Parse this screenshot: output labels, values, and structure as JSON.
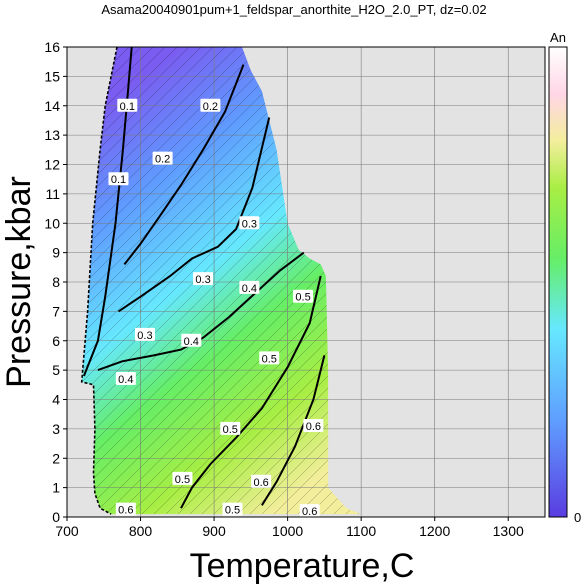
{
  "chart_data": {
    "type": "heatmap",
    "title": "Asama20040901pum+1_feldspar_anorthite_H2O_2.0_PT, dz=0.02",
    "xlabel": "Temperature,C",
    "ylabel": "Pressure,kbar",
    "xlim": [
      700,
      1350
    ],
    "ylim": [
      0,
      16
    ],
    "x_ticks": [
      "700",
      "800",
      "900",
      "1000",
      "1100",
      "1200",
      "1300"
    ],
    "y_ticks": [
      "0",
      "1",
      "2",
      "3",
      "4",
      "5",
      "6",
      "7",
      "8",
      "9",
      "10",
      "11",
      "12",
      "13",
      "14",
      "15",
      "16"
    ],
    "grid": true,
    "background_color": "#e3e3e3",
    "colorbar": {
      "title": "An",
      "min_label": "0",
      "min": 0,
      "max": 1,
      "colors": [
        "#7a5cf0",
        "#5f9cff",
        "#66e8ff",
        "#66ee66",
        "#a8ee44",
        "#f3ee9c",
        "#ffd6e6",
        "#ffffff"
      ]
    },
    "field_boundary_left": [
      [
        768,
        16
      ],
      [
        760,
        15
      ],
      [
        752,
        14
      ],
      [
        745,
        12.5
      ],
      [
        735,
        10
      ],
      [
        728,
        7
      ],
      [
        720,
        4.6
      ],
      [
        736,
        4.5
      ],
      [
        738,
        3
      ],
      [
        736,
        1.5
      ],
      [
        738,
        0.8
      ],
      [
        745,
        0.3
      ],
      [
        760,
        0.1
      ]
    ],
    "field_boundary_right": [
      [
        938,
        16
      ],
      [
        950,
        15.2
      ],
      [
        965,
        14.5
      ],
      [
        985,
        12.5
      ],
      [
        1000,
        10
      ],
      [
        1015,
        9.1
      ],
      [
        1030,
        8.8
      ],
      [
        1045,
        8.6
      ],
      [
        1052,
        8.2
      ],
      [
        1055,
        5
      ],
      [
        1055,
        1
      ],
      [
        1080,
        0.3
      ],
      [
        1100,
        0.1
      ]
    ],
    "contours": [
      {
        "level": "0.1",
        "points": [
          [
            788,
            16
          ],
          [
            783,
            14.5
          ],
          [
            776,
            12.5
          ],
          [
            766,
            10
          ],
          [
            752,
            7.5
          ],
          [
            742,
            6
          ],
          [
            723,
            4.8
          ]
        ]
      },
      {
        "level": "0.2",
        "points": [
          [
            940,
            15.4
          ],
          [
            915,
            13.8
          ],
          [
            885,
            12.5
          ],
          [
            855,
            11.3
          ],
          [
            825,
            10.2
          ],
          [
            800,
            9.3
          ],
          [
            778,
            8.6
          ]
        ]
      },
      {
        "level": "0.3",
        "points": [
          [
            975,
            13.6
          ],
          [
            952,
            11.2
          ],
          [
            930,
            9.8
          ],
          [
            905,
            9.2
          ],
          [
            870,
            8.8
          ],
          [
            840,
            8.2
          ],
          [
            800,
            7.5
          ],
          [
            770,
            7.0
          ]
        ]
      },
      {
        "level": "0.4",
        "points": [
          [
            1022,
            9.0
          ],
          [
            990,
            8.4
          ],
          [
            955,
            7.6
          ],
          [
            920,
            6.8
          ],
          [
            885,
            6.1
          ],
          [
            855,
            5.7
          ],
          [
            818,
            5.5
          ],
          [
            775,
            5.3
          ],
          [
            742,
            5.0
          ]
        ]
      },
      {
        "level": "0.5",
        "points": [
          [
            1045,
            8.2
          ],
          [
            1030,
            6.6
          ],
          [
            1000,
            5.1
          ],
          [
            965,
            3.7
          ],
          [
            930,
            2.7
          ],
          [
            895,
            1.8
          ],
          [
            870,
            1.0
          ],
          [
            855,
            0.3
          ]
        ]
      },
      {
        "level": "0.6",
        "points": [
          [
            1050,
            5.5
          ],
          [
            1035,
            4.0
          ],
          [
            1010,
            2.4
          ],
          [
            985,
            1.2
          ],
          [
            965,
            0.4
          ]
        ]
      }
    ],
    "contour_labels": [
      {
        "text": "0.1",
        "x": 782,
        "y": 14.0
      },
      {
        "text": "0.1",
        "x": 770,
        "y": 11.5
      },
      {
        "text": "0.2",
        "x": 895,
        "y": 14.0
      },
      {
        "text": "0.2",
        "x": 830,
        "y": 12.2
      },
      {
        "text": "0.3",
        "x": 948,
        "y": 10.0
      },
      {
        "text": "0.3",
        "x": 885,
        "y": 8.1
      },
      {
        "text": "0.3",
        "x": 806,
        "y": 6.2
      },
      {
        "text": "0.4",
        "x": 948,
        "y": 7.8
      },
      {
        "text": "0.4",
        "x": 869,
        "y": 6.0
      },
      {
        "text": "0.4",
        "x": 780,
        "y": 4.7
      },
      {
        "text": "0.5",
        "x": 1021,
        "y": 7.5
      },
      {
        "text": "0.5",
        "x": 975,
        "y": 5.4
      },
      {
        "text": "0.5",
        "x": 922,
        "y": 3.0
      },
      {
        "text": "0.5",
        "x": 857,
        "y": 1.3
      },
      {
        "text": "0.5",
        "x": 925,
        "y": 0.25
      },
      {
        "text": "0.6",
        "x": 1035,
        "y": 3.1
      },
      {
        "text": "0.6",
        "x": 964,
        "y": 1.2
      },
      {
        "text": "0.6",
        "x": 1030,
        "y": 0.2
      },
      {
        "text": "0.6",
        "x": 780,
        "y": 0.25
      }
    ]
  }
}
